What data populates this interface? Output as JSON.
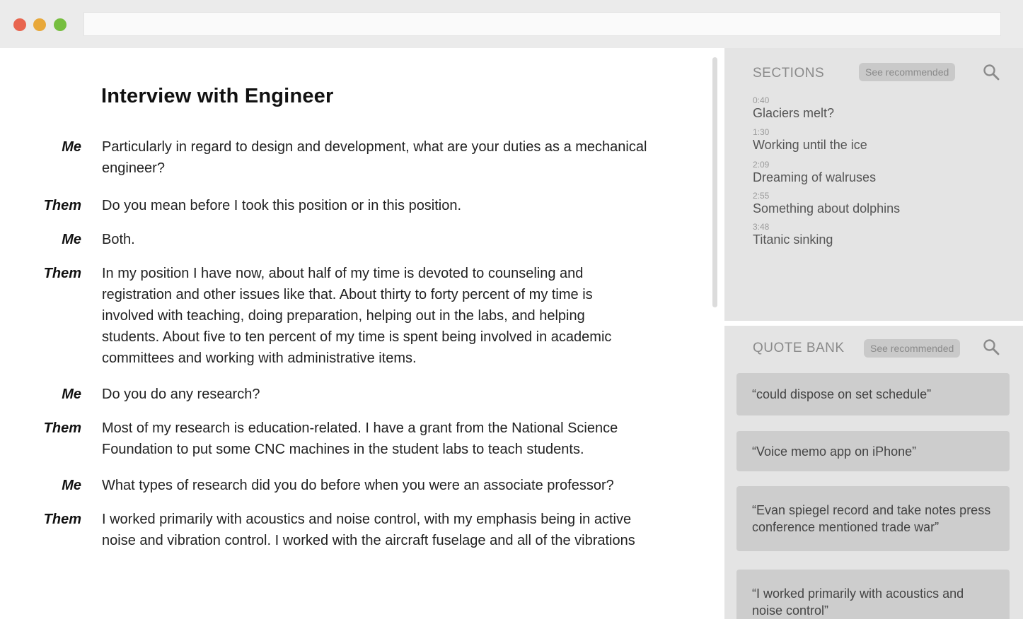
{
  "document": {
    "title": "Interview with Engineer",
    "turns": [
      {
        "speaker": "Me",
        "text": "Particularly in regard to design and development, what are your duties as a mechanical engineer?"
      },
      {
        "speaker": "Them",
        "text": "Do you mean before I took this position or in this position."
      },
      {
        "speaker": "Me",
        "text": "Both."
      },
      {
        "speaker": "Them",
        "text": "In my position I have now, about half of my time is devoted to counseling and registration and other issues like that. About thirty to forty percent of my time is involved with teaching, doing preparation, helping out in the labs, and helping students. About five to ten percent of my time is spent being involved in academic committees and working with administrative items."
      },
      {
        "speaker": "Me",
        "text": "Do you do any research?"
      },
      {
        "speaker": "Them",
        "text": "Most of my research is education-related. I have a grant from the National Science Foundation to put some CNC machines in the student labs to teach students."
      },
      {
        "speaker": "Me",
        "text": "What types of research did you do before when you were an associate professor?"
      },
      {
        "speaker": "Them",
        "text": "I worked primarily with acoustics and noise control, with my emphasis being in active noise and vibration control. I worked with the aircraft fuselage and all of the vibrations"
      }
    ]
  },
  "sections": {
    "heading": "SECTIONS",
    "recommend_label": "See recommended",
    "items": [
      {
        "time": "0:40",
        "label": "Glaciers melt?"
      },
      {
        "time": "1:30",
        "label": "Working until the ice"
      },
      {
        "time": "2:09",
        "label": "Dreaming of walruses"
      },
      {
        "time": "2:55",
        "label": "Something about dolphins"
      },
      {
        "time": "3:48",
        "label": "Titanic sinking"
      }
    ]
  },
  "quote_bank": {
    "heading": "QUOTE BANK",
    "recommend_label": "See recommended",
    "quotes": [
      "“could dispose on set schedule”",
      "“Voice memo app on iPhone”",
      "“Evan spiegel record and take notes press conference mentioned trade war”",
      "“I worked primarily with acoustics and noise control”"
    ]
  },
  "icons": {
    "search": "search-icon"
  },
  "colors": {
    "panel_bg": "#e4e4e4",
    "pill_bg": "#c9c9c9",
    "card_bg": "#cdcdcd",
    "chrome_bg": "#ebebeb"
  }
}
